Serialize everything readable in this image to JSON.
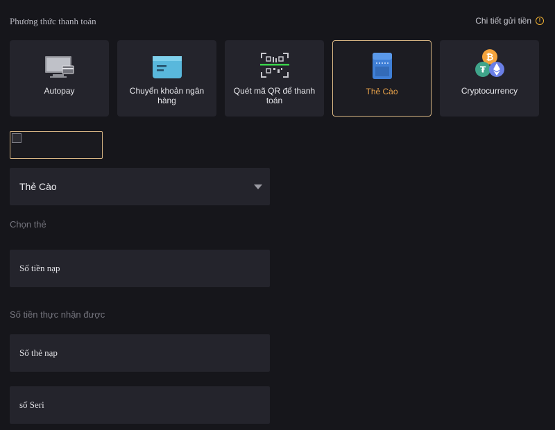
{
  "header": {
    "section_title": "Phương thức thanh toán",
    "detail_link": "Chi tiết gửi tiền"
  },
  "payment_methods": [
    {
      "label": "Autopay",
      "icon": "monitor-card-icon",
      "active": false
    },
    {
      "label": "Chuyển khoản ngân hàng",
      "icon": "bank-card-icon",
      "active": false
    },
    {
      "label": "Quét mã QR để thanh toán",
      "icon": "qr-scan-icon",
      "active": false
    },
    {
      "label": "Thẻ Cào",
      "icon": "scratch-card-icon",
      "active": true
    },
    {
      "label": "Cryptocurrency",
      "icon": "crypto-coins-icon",
      "active": false
    }
  ],
  "form": {
    "card_type_select": {
      "value": "Thẻ Cào"
    },
    "choose_card_label": "Chọn thẻ",
    "amount_field": {
      "placeholder": "Số tiền nạp"
    },
    "received_amount_label": "Số tiền thực nhận được",
    "card_number_field": {
      "placeholder": "Số thẻ nạp"
    },
    "serial_field": {
      "placeholder": "số Seri"
    }
  },
  "colors": {
    "background": "#16161b",
    "card": "#24242c",
    "accent_border": "#d8b684",
    "active_text": "#e8a24a",
    "info_icon": "#f2b233"
  }
}
